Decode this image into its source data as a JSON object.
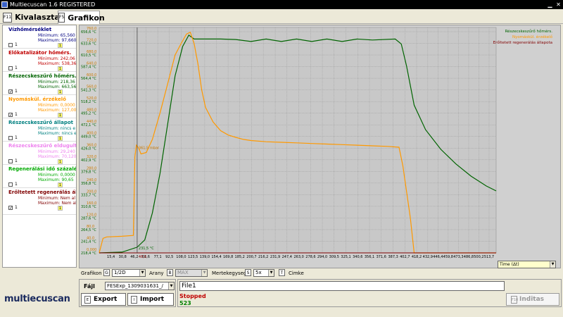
{
  "window": {
    "title": "Multiecuscan 1.6 REGISTERED"
  },
  "tabs": [
    {
      "key": "F11",
      "label": "Kivalasztas"
    },
    {
      "key": "F5",
      "label": "Grafikon"
    }
  ],
  "sensors": [
    {
      "title": "Vízhőmérséklet",
      "color": "#000080",
      "min": "Minimum: 65,560",
      "max": "Maximum: 97,660",
      "checked": false,
      "num": "1"
    },
    {
      "title": "Előkatalizátor hőmérs.",
      "color": "#c00000",
      "min": "Minimum: 242,06",
      "max": "Maximum: 538,36",
      "checked": false,
      "num": "1"
    },
    {
      "title": "Részecskeszűrő hőmérs.",
      "color": "#006400",
      "min": "Minimum: 218,36",
      "max": "Maximum: 663,56",
      "checked": true,
      "num": "1"
    },
    {
      "title": "Nyomáskül. érzékelő",
      "color": "#ff9900",
      "min": "Minimum: 0,0000",
      "max": "Maximum: 127,00",
      "checked": true,
      "num": "1"
    },
    {
      "title": "Részecskeszűrő állapot",
      "color": "#008080",
      "min": "Minimum: nincs e",
      "max": "Maximum: nincs e",
      "checked": false,
      "num": "1"
    },
    {
      "title": "Részecskeszűrő eldugult",
      "color": "#ee82ee",
      "min": "Minimum: 29,240",
      "max": "Maximum: 70,120",
      "checked": false,
      "num": "1"
    },
    {
      "title": "Regenerálási idő százaléka",
      "color": "#00aa00",
      "min": "Minimum: 0,0000",
      "max": "Maximum: 90,65",
      "checked": false,
      "num": "1"
    },
    {
      "title": "Erőltetett regenerálás állapot",
      "color": "#800000",
      "min": "Minimum: Nem al",
      "max": "Maximum: Nem al",
      "checked": true,
      "num": "1"
    }
  ],
  "chart_data": {
    "type": "line",
    "legend": [
      {
        "name": "Részecskeszűrő hőmérs.",
        "color": "#006400"
      },
      {
        "name": "Nyomáskül. érzékelő",
        "color": "#ff9900"
      },
      {
        "name": "Erőltetett regenerálás állapota",
        "color": "#800000"
      }
    ],
    "legend_position": "top-right",
    "grid": true,
    "xlim": [
      0,
      523
    ],
    "x_ticks": [
      "15,4",
      "30,8",
      "46,2",
      "61,6",
      "77,1",
      "92,5",
      "108,0",
      "123,5",
      "139,0",
      "154,4",
      "169,8",
      "185,2",
      "200,7",
      "216,2",
      "231,9",
      "247,4",
      "263,0",
      "278,6",
      "294,0",
      "309,5",
      "325,1",
      "340,6",
      "356,1",
      "371,6",
      "387,3",
      "402,7",
      "418,2",
      "432,9",
      "446,4",
      "459,8",
      "473,3",
      "486,8",
      "500,2",
      "513,7"
    ],
    "y_ticks_left": [
      "656,6 °C",
      "633,6 °C",
      "610,5 °C",
      "587,4 °C",
      "564,4 °C",
      "541,3 °C",
      "518,2 °C",
      "495,2 °C",
      "472,1 °C",
      "449,0 °C",
      "426,0 °C",
      "402,9 °C",
      "379,8 °C",
      "356,8 °C",
      "333,7 °C",
      "310,6 °C",
      "287,6 °C",
      "264,5 °C",
      "241,4 °C",
      "218,4 °C"
    ],
    "y_ticks_right": [
      "760,0",
      "720,0",
      "680,0",
      "640,0",
      "600,0",
      "560,0",
      "520,0",
      "480,0",
      "440,0",
      "400,0",
      "360,0",
      "320,0",
      "280,0",
      "240,0",
      "200,0",
      "160,0",
      "120,0",
      "80,0",
      "40,0",
      "0,000"
    ],
    "ylim_temp": [
      218.4,
      670
    ],
    "ylim_pressure": [
      0,
      760
    ],
    "cursor": {
      "x": 50,
      "label_left": "231,5 °C",
      "label_mid": "361,5 mbar",
      "label_bottom": "48,8"
    },
    "series": [
      {
        "name": "Részecskeszűrő hőmérs.",
        "color": "#006400",
        "unit": "°C",
        "points": [
          [
            0,
            218.4
          ],
          [
            30,
            220
          ],
          [
            50,
            230
          ],
          [
            60,
            245
          ],
          [
            70,
            300
          ],
          [
            80,
            380
          ],
          [
            90,
            480
          ],
          [
            100,
            580
          ],
          [
            110,
            640
          ],
          [
            118,
            663
          ],
          [
            125,
            655
          ],
          [
            140,
            655
          ],
          [
            160,
            655
          ],
          [
            180,
            654
          ],
          [
            200,
            650
          ],
          [
            220,
            655
          ],
          [
            240,
            650
          ],
          [
            260,
            655
          ],
          [
            280,
            650
          ],
          [
            300,
            655
          ],
          [
            320,
            650
          ],
          [
            340,
            655
          ],
          [
            360,
            653
          ],
          [
            390,
            655
          ],
          [
            398,
            645
          ],
          [
            405,
            600
          ],
          [
            415,
            520
          ],
          [
            430,
            470
          ],
          [
            450,
            430
          ],
          [
            470,
            400
          ],
          [
            490,
            375
          ],
          [
            510,
            355
          ],
          [
            523,
            345
          ]
        ]
      },
      {
        "name": "Nyomáskül. érzékelő",
        "color": "#ff9900",
        "unit": "mbar",
        "points": [
          [
            0,
            0
          ],
          [
            5,
            50
          ],
          [
            10,
            55
          ],
          [
            30,
            57
          ],
          [
            45,
            60
          ],
          [
            47,
            330
          ],
          [
            49,
            370
          ],
          [
            52,
            360
          ],
          [
            55,
            340
          ],
          [
            62,
            345
          ],
          [
            70,
            390
          ],
          [
            80,
            480
          ],
          [
            90,
            580
          ],
          [
            100,
            680
          ],
          [
            108,
            720
          ],
          [
            115,
            752
          ],
          [
            120,
            758
          ],
          [
            125,
            720
          ],
          [
            130,
            650
          ],
          [
            135,
            560
          ],
          [
            140,
            500
          ],
          [
            150,
            450
          ],
          [
            160,
            420
          ],
          [
            170,
            405
          ],
          [
            180,
            397
          ],
          [
            190,
            390
          ],
          [
            200,
            386
          ],
          [
            220,
            382
          ],
          [
            240,
            380
          ],
          [
            260,
            378
          ],
          [
            280,
            376
          ],
          [
            300,
            374
          ],
          [
            320,
            372
          ],
          [
            340,
            370
          ],
          [
            360,
            368
          ],
          [
            380,
            366
          ],
          [
            395,
            363
          ],
          [
            400,
            300
          ],
          [
            410,
            120
          ],
          [
            415,
            0
          ],
          [
            523,
            0
          ]
        ]
      },
      {
        "name": "Erőltetett regenerálás állapota",
        "color": "#800000",
        "unit": "",
        "points": [
          [
            0,
            0
          ],
          [
            523,
            0
          ]
        ]
      }
    ]
  },
  "toolbar": {
    "grafikon_label": "Grafikon",
    "grafikon_key": "G",
    "grafikon_value": "1/2D",
    "arany_label": "Arany",
    "arany_key": "B",
    "arany_value": "MAX",
    "mertek_label": "Mertekegyseg",
    "mertek_key": "S",
    "mertek_value": "5x",
    "cimke_key": "T",
    "cimke_label": "Cimke",
    "time_select": "Time (Δt)"
  },
  "file": {
    "label": "Fájl",
    "value": "FESExp_1309031631_/",
    "export_key": "E",
    "export_label": "Export",
    "import_key": "I",
    "import_label": "Import"
  },
  "status": {
    "file_name": "File1",
    "state": "Stopped",
    "count": "523",
    "start_key": "F10",
    "start_label": "Inditas"
  },
  "logo": {
    "text": "multiecuscan"
  }
}
